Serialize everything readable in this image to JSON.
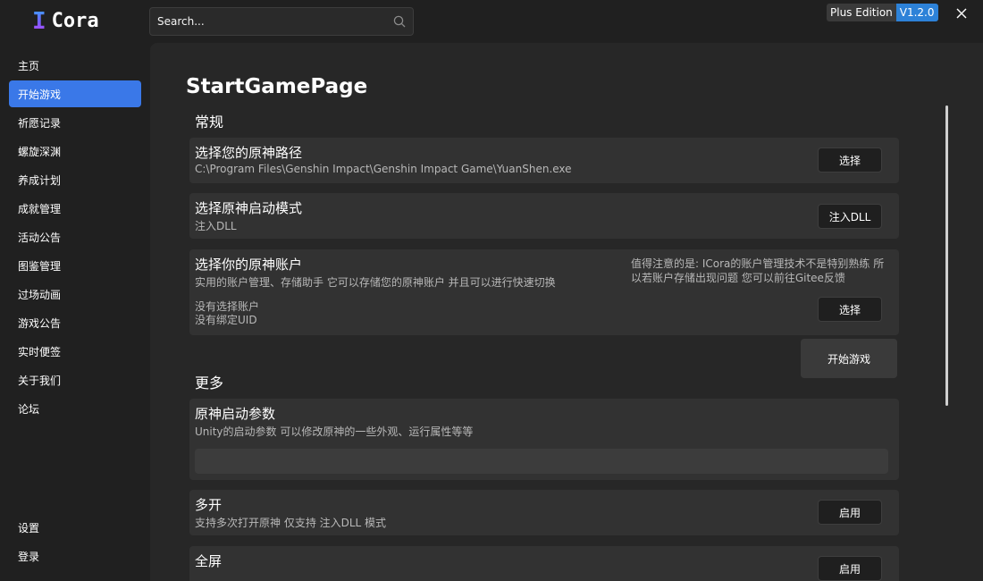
{
  "app": {
    "logo_mark": "I",
    "name": "Cora",
    "edition_label": "Plus Edition",
    "version": "V1.2.0"
  },
  "search": {
    "placeholder": "Search..."
  },
  "sidebar": {
    "items": [
      {
        "label": "主页",
        "active": false
      },
      {
        "label": "开始游戏",
        "active": true
      },
      {
        "label": "祈愿记录",
        "active": false
      },
      {
        "label": "螺旋深渊",
        "active": false
      },
      {
        "label": "养成计划",
        "active": false
      },
      {
        "label": "成就管理",
        "active": false
      },
      {
        "label": "活动公告",
        "active": false
      },
      {
        "label": "图鉴管理",
        "active": false
      },
      {
        "label": "过场动画",
        "active": false
      },
      {
        "label": "游戏公告",
        "active": false
      },
      {
        "label": "实时便签",
        "active": false
      },
      {
        "label": "关于我们",
        "active": false
      },
      {
        "label": "论坛",
        "active": false
      }
    ],
    "bottom_items": [
      {
        "label": "设置"
      },
      {
        "label": "登录"
      }
    ]
  },
  "page": {
    "title": "StartGamePage",
    "sections": {
      "general": "常规",
      "more": "更多"
    },
    "path_card": {
      "title": "选择您的原神路径",
      "value": "C:\\Program Files\\Genshin Impact\\Genshin Impact Game\\YuanShen.exe",
      "button": "选择"
    },
    "mode_card": {
      "title": "选择原神启动模式",
      "value": "注入DLL",
      "button": "注入DLL"
    },
    "account_card": {
      "title": "选择你的原神账户",
      "description": "实用的账户管理、存储助手 它可以存储您的原神账户 并且可以进行快速切换",
      "note": "值得注意的是: ICora的账户管理技术不是特别熟练 所以若账户存储出现问题 您可以前往Gitee反馈",
      "account_status": "没有选择账户",
      "uid_status": "没有绑定UID",
      "button": "选择"
    },
    "start_button": "开始游戏",
    "args_card": {
      "title": "原神启动参数",
      "description": "Unity的启动参数 可以修改原神的一些外观、运行属性等等",
      "value": ""
    },
    "multi_card": {
      "title": "多开",
      "description": "支持多次打开原神 仅支持 注入DLL 模式",
      "button": "启用"
    },
    "fullscreen_card": {
      "title": "全屏",
      "button": "启用"
    }
  },
  "colors": {
    "accent": "#3a78e8",
    "version_badge": "#2d82d8",
    "background": "#202020",
    "content": "#272727",
    "card": "#323232"
  }
}
